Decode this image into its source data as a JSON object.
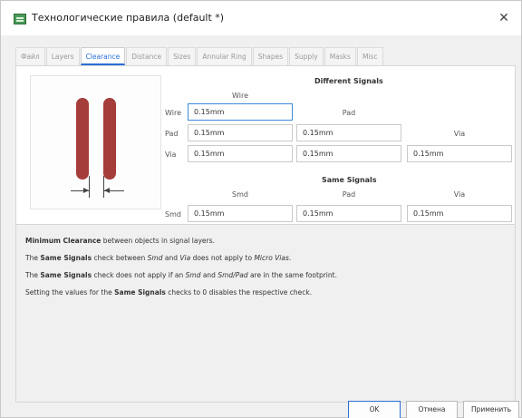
{
  "window": {
    "title": "Технологические правила (default *)",
    "close_glyph": "✕"
  },
  "tabs": [
    {
      "label": "Файл"
    },
    {
      "label": "Layers"
    },
    {
      "label": "Clearance",
      "active": true
    },
    {
      "label": "Distance"
    },
    {
      "label": "Sizes"
    },
    {
      "label": "Annular Ring"
    },
    {
      "label": "Shapes"
    },
    {
      "label": "Supply"
    },
    {
      "label": "Masks"
    },
    {
      "label": "Misc"
    }
  ],
  "different_signals": {
    "title": "Different Signals",
    "col_wire": "Wire",
    "col_pad": "Pad",
    "col_via": "Via",
    "row_wire": "Wire",
    "row_pad": "Pad",
    "row_via": "Via",
    "wire_wire": "0.15mm",
    "pad_wire": "0.15mm",
    "pad_pad": "0.15mm",
    "via_wire": "0.15mm",
    "via_pad": "0.15mm",
    "via_via": "0.15mm"
  },
  "same_signals": {
    "title": "Same Signals",
    "col_smd": "Smd",
    "col_pad": "Pad",
    "col_via": "Via",
    "row_smd": "Smd",
    "smd_smd": "0.15mm",
    "smd_pad": "0.15mm",
    "smd_via": "0.15mm"
  },
  "info": {
    "line1_b1": "Minimum Clearance",
    "line1_t1": " between objects in signal layers.",
    "line2_t1": "The ",
    "line2_b1": "Same Signals",
    "line2_t2": " check between ",
    "line2_i1": "Smd",
    "line2_t3": " and ",
    "line2_i2": "Via",
    "line2_t4": " does not apply to ",
    "line2_i3": "Micro Vias",
    "line2_t5": ".",
    "line3_t1": "The ",
    "line3_b1": "Same Signals",
    "line3_t2": " check does not apply if an ",
    "line3_i1": "Smd",
    "line3_t3": " and ",
    "line3_i2": "Smd/Pad",
    "line3_t4": " are in the same footprint.",
    "line4_t1": "Setting the values for the ",
    "line4_b1": "Same Signals",
    "line4_t2": " checks to 0 disables the respective check."
  },
  "buttons": {
    "ok": "OK",
    "cancel": "Отмена",
    "apply": "Применить"
  },
  "colors": {
    "accent": "#2a6ed6",
    "track": "#a53d3a"
  }
}
